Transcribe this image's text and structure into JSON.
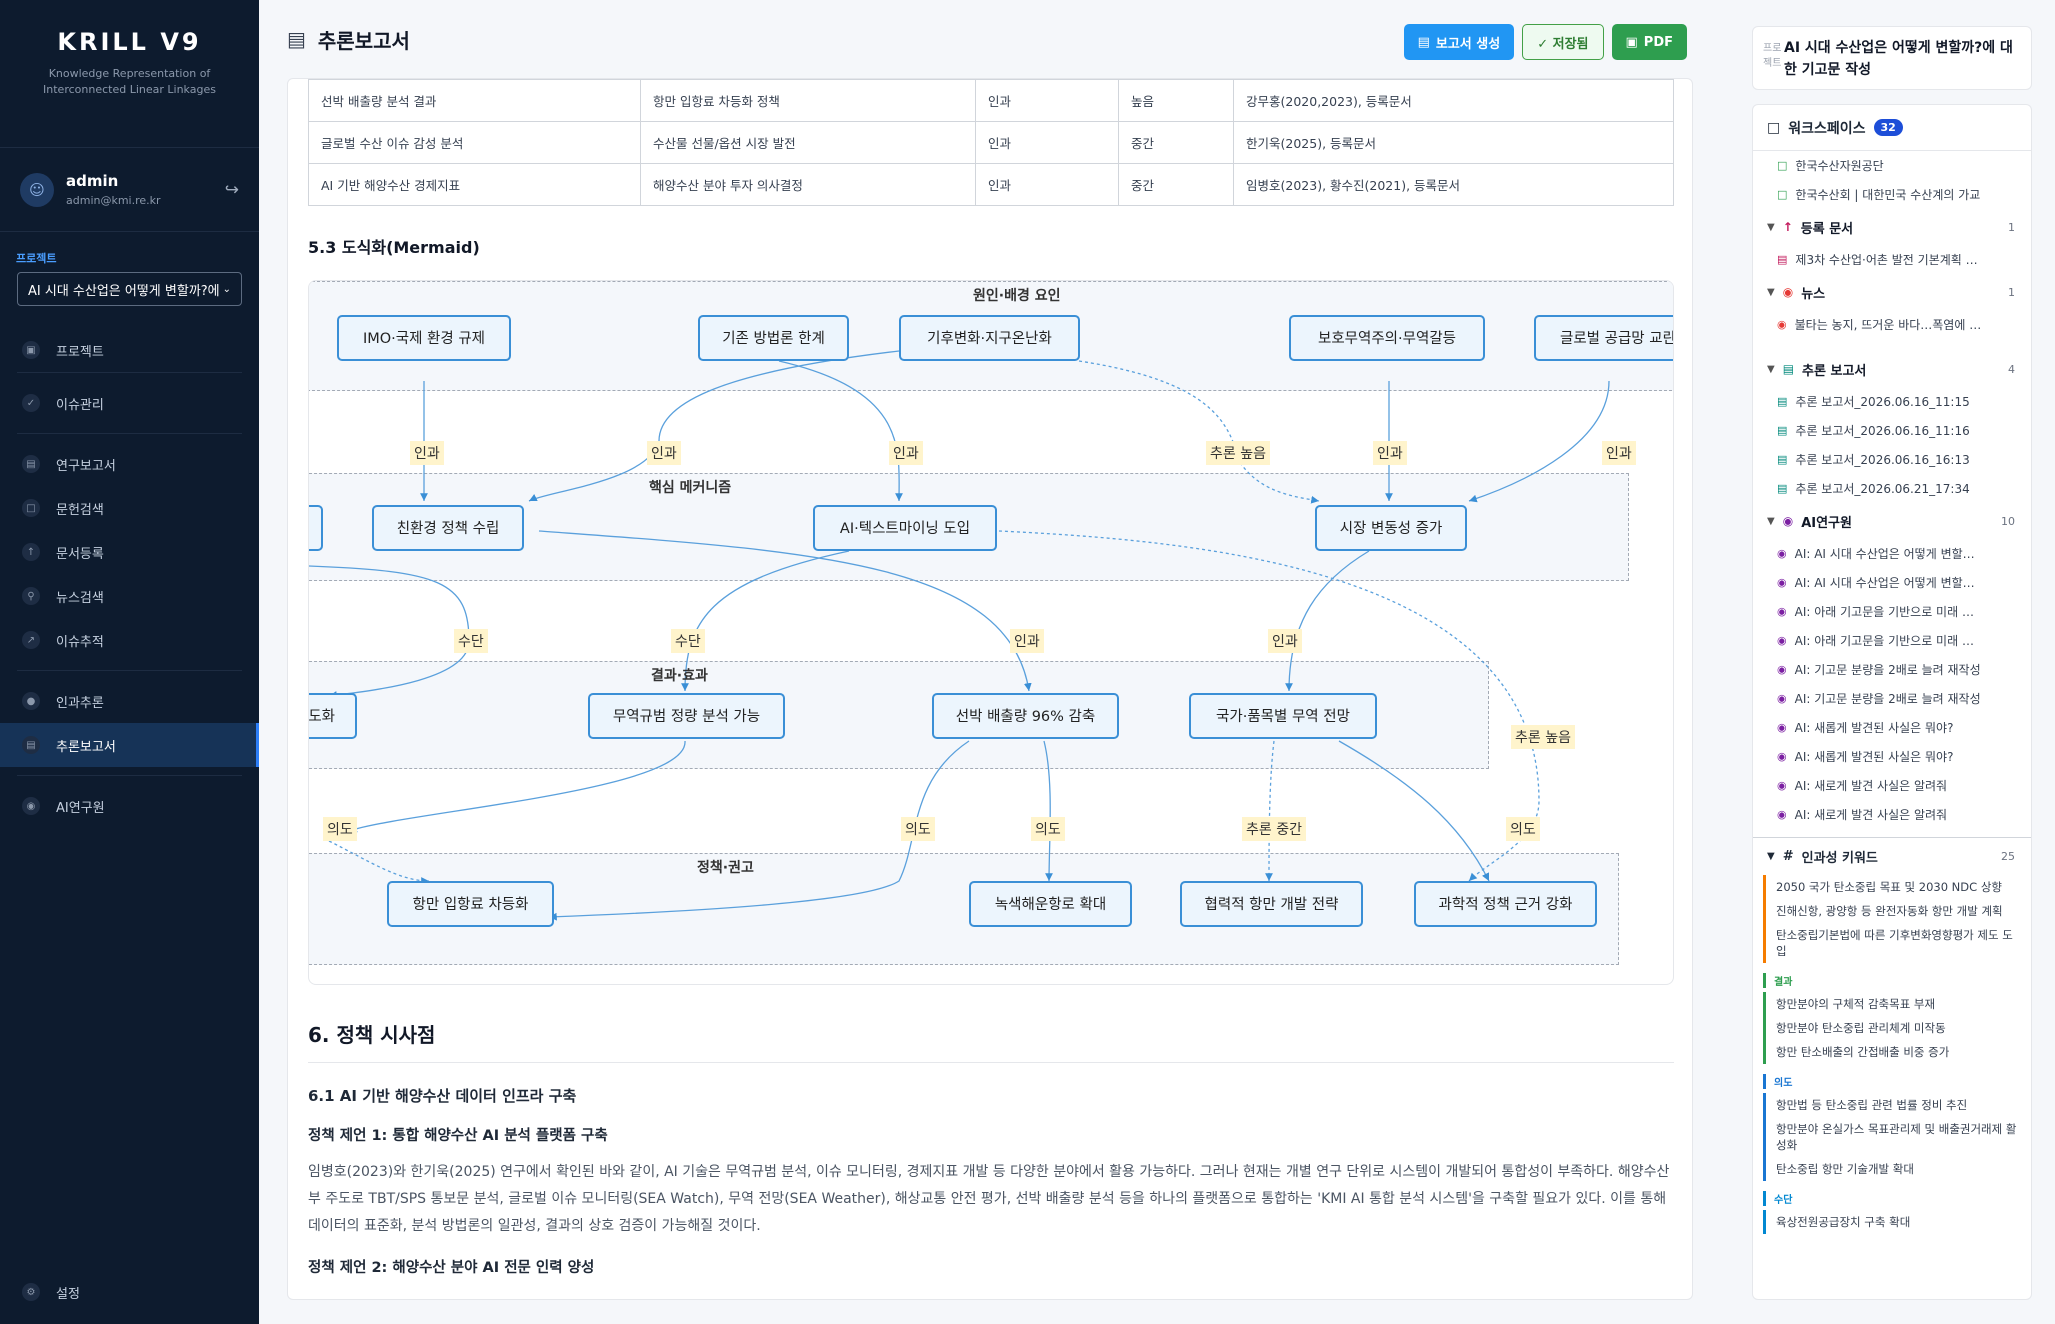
{
  "sidebar": {
    "brand": "KRILL V9",
    "brand_sub1": "Knowledge Representation of",
    "brand_sub2": "Interconnected Linear Linkages",
    "user": {
      "name": "admin",
      "email": "admin@kmi.re.kr"
    },
    "project_label": "프로젝트",
    "project_value": "AI 시대 수산업은 어떻게 변할까?에",
    "nav": {
      "projects": "프로젝트",
      "issues": "이슈관리",
      "reports": "연구보고서",
      "literature": "문헌검색",
      "docreg": "문서등록",
      "news": "뉴스검색",
      "tracking": "이슈추적",
      "causal": "인과추론",
      "inference": "추론보고서",
      "ai": "AI연구원",
      "settings": "설정"
    }
  },
  "header": {
    "title": "추론보고서",
    "btn_generate": "보고서 생성",
    "btn_saved": "✓ 저장됨",
    "btn_pdf": "PDF"
  },
  "table": {
    "rows": [
      [
        "선박 배출량 분석 결과",
        "항만 입항료 차등화 정책",
        "인과",
        "높음",
        "강무홍(2020,2023), 등록문서"
      ],
      [
        "글로벌 수산 이슈 감성 분석",
        "수산물 선물/옵션 시장 발전",
        "인과",
        "중간",
        "한기욱(2025), 등록문서"
      ],
      [
        "AI 기반 해양수산 경제지표",
        "해양수산 분야 투자 의사결정",
        "인과",
        "중간",
        "임병호(2023), 황수진(2021), 등록문서"
      ]
    ]
  },
  "section53": "5.3 도식화(Mermaid)",
  "diagram": {
    "subgraphs": {
      "cause": "원인·배경 요인",
      "mech": "핵심 메커니즘",
      "result": "결과·효과",
      "policy": "정책·권고"
    },
    "nodes": {
      "imo": "IMO·국제 환경 규제",
      "law": "기존 방법론 한계",
      "climate": "기후변화·지구온난화",
      "protect": "보호무역주의·무역갈등",
      "supply": "글로벌 공급망 교란",
      "eco": "친환경 정책 수립",
      "aitext": "AI·텍스트마이닝 도입",
      "market": "시장 변동성 증가",
      "leftcut": "도화",
      "trade": "무역규범 정량 분석 가능",
      "ship": "선박 배출량 96% 감축",
      "country": "국가·품목별 무역 전망",
      "port": "항만 입항료 차등화",
      "green": "녹색해운항로 확대",
      "coop": "협력적 항만 개발 전략",
      "sci": "과학적 정책 근거 강화"
    },
    "edge_labels": {
      "causal": "인과",
      "infer_high": "추론 높음",
      "means": "수단",
      "intent": "의도",
      "infer_mid": "추론 중간"
    }
  },
  "section6": {
    "title": "6. 정책 시사점",
    "s61": "6.1 AI 기반 해양수산 데이터 인프라 구축",
    "p1title": "정책 제언 1: 통합 해양수산 AI 분석 플랫폼 구축",
    "p1text": "임병호(2023)와 한기욱(2025) 연구에서 확인된 바와 같이, AI 기술은 무역규범 분석, 이슈 모니터링, 경제지표 개발 등 다양한 분야에서 활용 가능하다. 그러나 현재는 개별 연구 단위로 시스템이 개발되어 통합성이 부족하다. 해양수산부 주도로 TBT/SPS 통보문 분석, 글로벌 이슈 모니터링(SEA Watch), 무역 전망(SEA Weather), 해상교통 안전 평가, 선박 배출량 분석 등을 하나의 플랫폼으로 통합하는 'KMI AI 통합 분석 시스템'을 구축할 필요가 있다. 이를 통해 데이터의 표준화, 분석 방법론의 일관성, 결과의 상호 검증이 가능해질 것이다.",
    "p2title": "정책 제언 2: 해양수산 분야 AI 전문 인력 양성"
  },
  "right": {
    "project_label": "프로젝트",
    "project_title": "AI 시대 수산업은 어떻게 변할까?에 대한 기고문 작성",
    "ws_title": "워크스페이스",
    "ws_count": "32",
    "top_items": [
      "한국수산자원공단",
      "한국수산회 | 대한민국 수산계의 가교"
    ],
    "groups": {
      "docs": {
        "label": "등록 문서",
        "count": "1",
        "items": [
          "제3차 수산업·어촌 발전 기본계획 …"
        ]
      },
      "news": {
        "label": "뉴스",
        "count": "1",
        "items": [
          "불타는 농지, 뜨거운 바다…폭염에 …"
        ]
      },
      "reports": {
        "label": "추론 보고서",
        "count": "4",
        "items": [
          "추론 보고서_2026.06.16_11:15",
          "추론 보고서_2026.06.16_11:16",
          "추론 보고서_2026.06.16_16:13",
          "추론 보고서_2026.06.21_17:34"
        ]
      },
      "ai": {
        "label": "AI연구원",
        "count": "10",
        "items": [
          "AI: AI 시대 수산업은 어떻게 변할…",
          "AI: AI 시대 수산업은 어떻게 변할…",
          "AI: 아래 기고문을 기반으로 미래 …",
          "AI: 아래 기고문을 기반으로 미래 …",
          "AI: 기고문 분량을 2배로 늘려 재작성",
          "AI: 기고문 분량을 2배로 늘려 재작성",
          "AI: 새롭게 발견된 사실은 뭐야?",
          "AI: 새롭게 발견된 사실은 뭐야?",
          "AI: 새로게 발견 사실은 알려줘",
          "AI: 새로게 발견 사실은 알려줘"
        ]
      }
    },
    "kw_title": "인과성 키워드",
    "kw_count": "25",
    "kw_top": [
      "2050 국가 탄소중립 목표 및 2030 NDC 상향",
      "진해신항, 광양항 등 완전자동화 항만 개발 계획",
      "탄소중립기본법에 따른 기후변화영향평가 제도 도입"
    ],
    "kw_result_label": "결과",
    "kw_result": [
      "항만분야의 구체적 감축목표 부재",
      "항만분야 탄소중립 관리체계 미작동",
      "항만 탄소배출의 간접배출 비중 증가"
    ],
    "kw_intent_label": "의도",
    "kw_intent": [
      "항만법 등 탄소중립 관련 법률 정비 추진",
      "항만분야 온실가스 목표관리제 및 배출권거래제 활성화",
      "탄소중립 항만 기술개발 확대"
    ],
    "kw_means_label": "수단",
    "kw_means": [
      "육상전원공급장치 구축 확대"
    ]
  }
}
